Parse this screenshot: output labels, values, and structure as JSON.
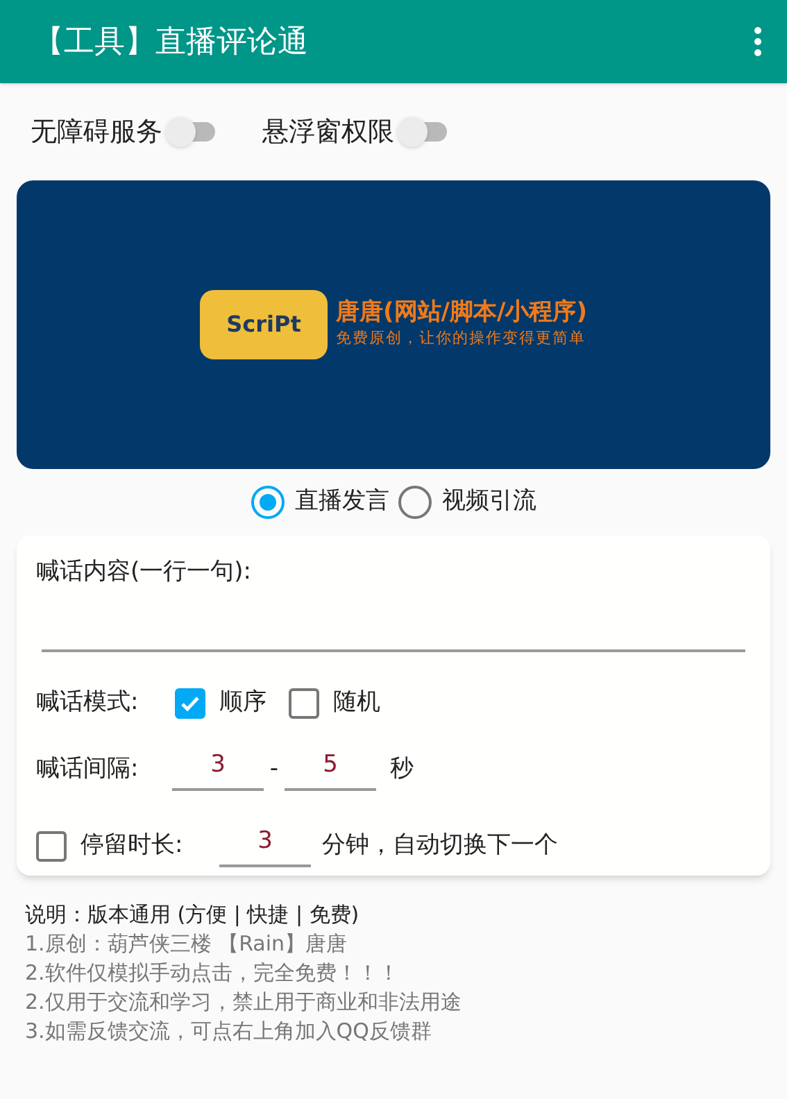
{
  "app_bar": {
    "title": "【工具】直播评论通"
  },
  "permissions": [
    {
      "label": "无障碍服务",
      "on": false
    },
    {
      "label": "悬浮窗权限",
      "on": false
    }
  ],
  "banner": {
    "logo_text": "ScriPt",
    "headline": "唐唐(网站/脚本/小程序)",
    "tagline": "免费原创，让你的操作变得更简单"
  },
  "modes": [
    {
      "label": "直播发言",
      "selected": true
    },
    {
      "label": "视频引流",
      "selected": false
    }
  ],
  "form": {
    "content_label": "喊话内容(一行一句):",
    "mode_label": "喊话模式:",
    "mode_options": [
      {
        "label": "顺序",
        "checked": true
      },
      {
        "label": "随机",
        "checked": false
      }
    ],
    "interval_label": "喊话间隔:",
    "interval_min": "3",
    "interval_sep": "-",
    "interval_max": "5",
    "interval_unit": "秒",
    "stay": {
      "checked": false,
      "label": "停留时长:",
      "value": "3",
      "suffix": "分钟，自动切换下一个"
    }
  },
  "notes": {
    "title": "说明：版本通用 (方便 | 快捷 | 免费)",
    "lines": [
      "1.原创：葫芦侠三楼 【Rain】唐唐",
      "2.软件仅模拟手动点击，完全免费！！！",
      "2.仅用于交流和学习，禁止用于商业和非法用途",
      "3.如需反馈交流，可点右上角加入QQ反馈群"
    ]
  }
}
